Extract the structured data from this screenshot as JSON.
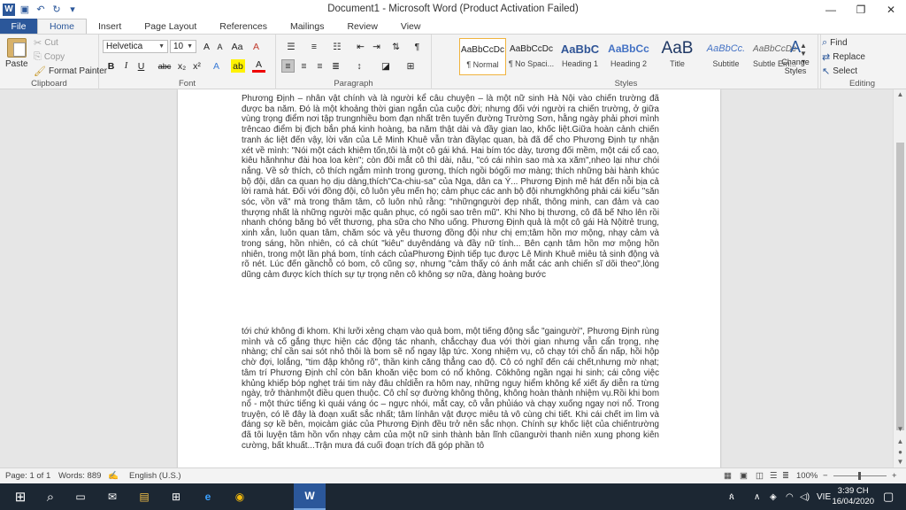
{
  "window": {
    "title": "Document1  -  Microsoft Word (Product Activation Failed)",
    "minimize": "—",
    "restore": "❐",
    "close": "✕"
  },
  "qat": {
    "logo": "W",
    "save": "▣",
    "undo": "↶",
    "redo": "↻",
    "customize": "▾"
  },
  "tabs": [
    "File",
    "Home",
    "Insert",
    "Page Layout",
    "References",
    "Mailings",
    "Review",
    "View"
  ],
  "ribbon": {
    "clipboard": {
      "label": "Clipboard",
      "paste": "Paste",
      "cut": "Cut",
      "copy": "Copy",
      "format_painter": "Format Painter"
    },
    "font": {
      "label": "Font",
      "font_name": "Helvetica",
      "font_size": "10",
      "grow": "A",
      "shrink": "A",
      "change_case": "Aa",
      "clear": "A",
      "bold": "B",
      "italic": "I",
      "underline": "U",
      "strike": "abc",
      "subscript": "x₂",
      "superscript": "x²",
      "effects": "A",
      "highlight": "ab",
      "color": "A"
    },
    "paragraph": {
      "label": "Paragraph",
      "show_marks": "¶"
    },
    "styles": {
      "label": "Styles",
      "items": [
        {
          "sample": "AaBbCcDc",
          "name": "¶ Normal"
        },
        {
          "sample": "AaBbCcDc",
          "name": "¶ No Spaci..."
        },
        {
          "sample": "AaBbC",
          "name": "Heading 1"
        },
        {
          "sample": "AaBbCc",
          "name": "Heading 2"
        },
        {
          "sample": "AaB",
          "name": "Title"
        },
        {
          "sample": "AaBbCc.",
          "name": "Subtitle"
        },
        {
          "sample": "AaBbCcDc",
          "name": "Subtle Em..."
        }
      ],
      "change_styles": "Change Styles"
    },
    "editing": {
      "label": "Editing",
      "find": "Find",
      "replace": "Replace",
      "select": "Select"
    }
  },
  "document": {
    "para1": "Phương Định – nhân vật chính và là người kể câu chuyện – là một nữ sinh Hà Nội vào chiến trường đã được ba năm. Đó là một khoảng thời gian ngắn của cuộc đời; nhưng đối với người ra chiến trường, ở giữa vùng trọng điểm nơi tập trungnhiều bom đạn nhất trên tuyến đường Trường Sơn, hằng ngày phải phơi mình trêncao điểm bị địch bắn phá kinh hoàng, ba năm thật dài và đầy gian lao, khốc liệt.Giữa hoàn cảnh chiến tranh ác liệt đến vậy, lời văn của Lê Minh Khuê vẫn tràn đầylạc quan, bà đã để cho Phương Định tự nhận xét về mình: \"Nói một cách khiêm tốn,tôi là một cô gái khá. Hai bím tóc dày, tương đối mềm, một cái cổ cao, kiêu hãnhnhư đài hoa loa kèn\"; còn đôi mắt cô thì dài, nâu, \"có cái nhìn sao mà xa xăm\",nheo lại như chói nắng. Về sở thích, cô thích ngắm mình trong gương, thích ngồi bógối mơ màng; thích những bài hành khúc bộ đội, dân ca quan họ dịu dàng,thích\"Ca-chiu-sa\" của Nga, dân ca Ý... Phương Định mê hát đến nỗi bịa cả lời ramà hát. Đối với đồng đội, cô luôn yêu mến họ; cảm phục các anh bộ đội nhưngkhông phải cái kiểu \"săn sóc, vồn vã\" mà trong thâm tâm, cô luôn nhủ rằng: \"nhữngngười đẹp nhất, thông minh, can đảm và cao thượng nhất là những người mặc quân phục, có ngôi sao trên mũ\". Khi Nho bị thương, cô đã bế Nho lên rồi nhanh chóng băng bó vết thương, pha sữa cho Nho uống. Phương Định quả là một cô gái Hà Nộitrẻ trung, xinh xắn, luôn quan tâm, chăm sóc và yêu thương đồng đội như chị em;tâm hồn mơ mộng, nhạy cảm và trong sáng, hồn nhiên, có cả chút \"kiêu\" duyêndáng và đầy nữ tính... Bên cạnh tâm hồn mơ mộng hồn nhiên, trong một lần phá bom, tính cách củaPhương Định tiếp tục được Lê Minh Khuê miêu tả sinh động và rõ nét. Lúc đến gầnchỗ có bom, cô cũng sợ, nhưng \"cảm thấy có ánh mắt các anh chiến sĩ dõi theo\",lòng dũng cảm được kích thích sự tự trọng nên cô không sợ nữa, đàng hoàng bước",
    "para2": "tới chứ không đi khom. Khi lưỡi xẻng chạm vào quả bom, một tiếng động sắc \"gaingười\", Phương Định rùng mình và cố gắng thực hiện các động tác nhanh, chắcchạy đua với thời gian nhưng vẫn cẩn trọng, nhẹ nhàng; chỉ cần sai sót nhỏ thôi là bom sẽ nổ ngay lập tức. Xong nhiệm vụ, cô chạy tới chỗ ẩn nấp, hồi hộp chờ đợi, lolắng, \"tim đập không rõ\", thần kinh căng thẳng cao độ. Cô có nghĩ đến cái chết,nhưng mờ nhạt; tâm trí Phương Định chỉ còn băn khoăn việc bom có nổ không. Côkhông ngần ngại hi sinh; cái công việc khủng khiếp bóp nghẹt trái tim này đâu chỉdiễn ra hôm nay, những nguy hiểm không kể xiết ấy diễn ra từng ngày, trở thànhmột điều quen thuộc. Cô chỉ sợ đường không thông, không hoàn thành nhiệm vụ.Rồi khi bom nổ - một thức tiếng kì quái váng óc – ngực nhói, mắt cay, cô vẫn phủiáo và chạy xuống ngay nơi nổ. Trong truyện, có lẽ đây là đoạn xuất sắc nhất; tâm línhân vật được miêu tả vô cùng chi tiết. Khi cái chết im lìm và đáng sợ kề bên, mọicảm giác của Phương Định đều trở nên sắc nhọn. Chính sự khốc liệt của chiếntrường đã tôi luyện tâm hồn vốn nhạy cảm của một nữ sinh thành bản lĩnh cũangười thanh niên xung phong kiên cường, bất khuất...Trận mưa đá cuối đoạn trích đã góp phần tô"
  },
  "status": {
    "page": "Page: 1 of 1",
    "words": "Words: 889",
    "language": "English (U.S.)",
    "zoom": "100%",
    "zoom_minus": "−",
    "zoom_plus": "+"
  },
  "taskbar": {
    "start": "⊞",
    "search": "⌕",
    "taskview": "▭",
    "apps": [
      "✉",
      "▤",
      "⊞",
      "e",
      "◉",
      "W"
    ],
    "people": "ጰ",
    "tray_up": "∧",
    "language": "VIE",
    "time": "3:39 CH",
    "date": "16/04/2020",
    "notifications": "▢"
  }
}
